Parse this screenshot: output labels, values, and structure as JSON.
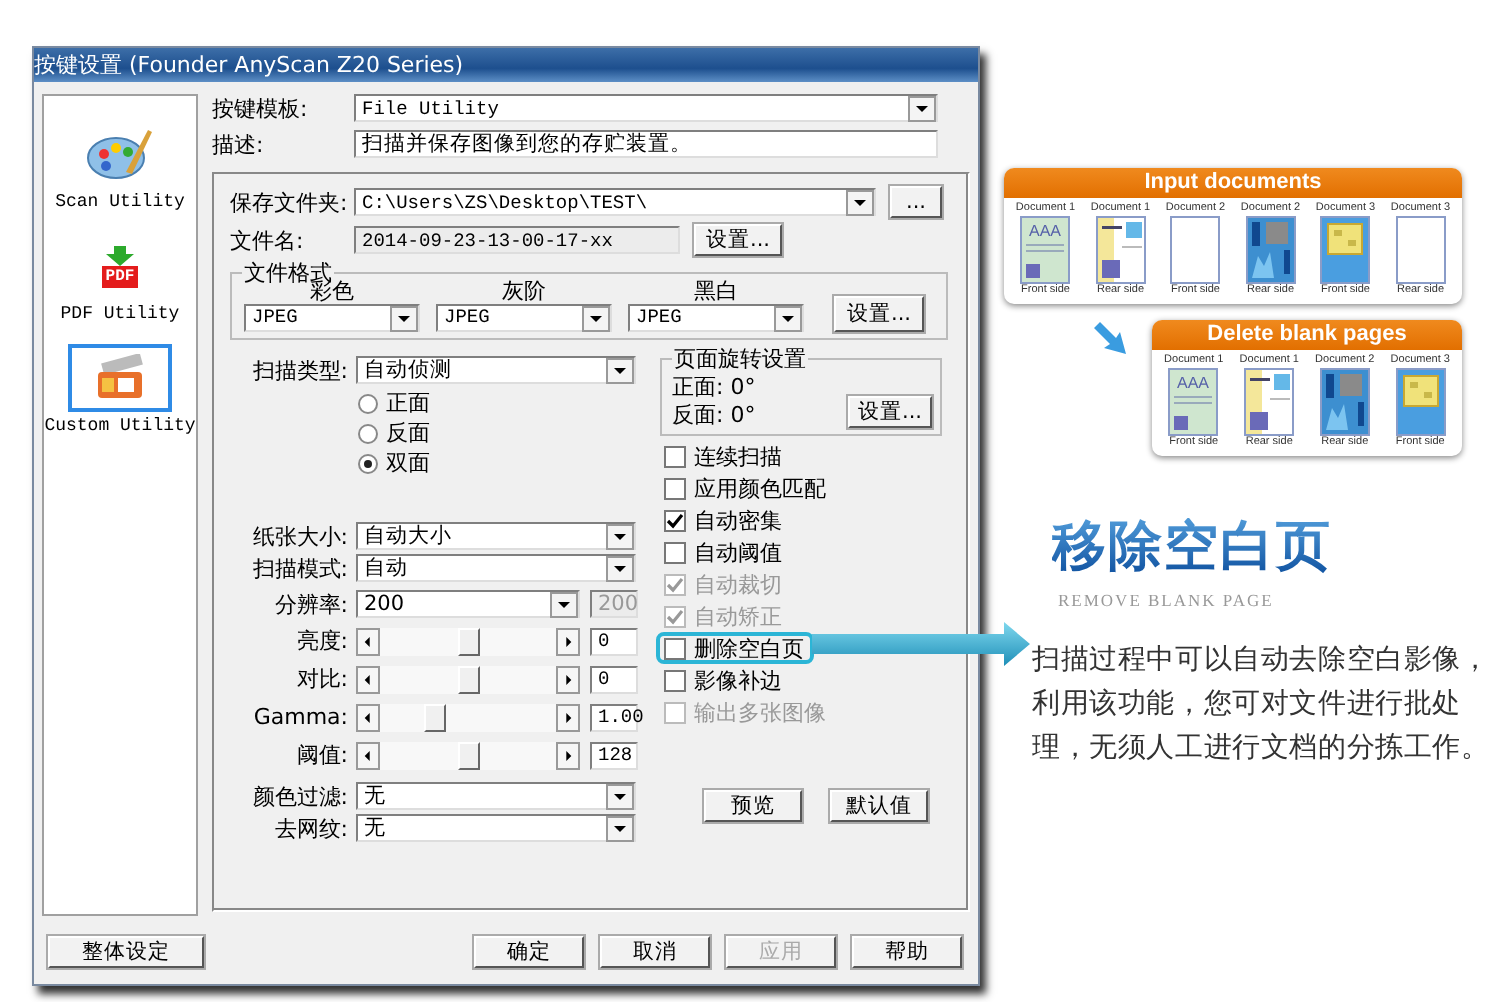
{
  "window": {
    "title": "按键设置 (Founder AnyScan Z20 Series)"
  },
  "sidebar": {
    "items": [
      {
        "label": "Scan Utility",
        "kind": "palette",
        "selected": false
      },
      {
        "label": "PDF Utility",
        "kind": "pdf",
        "badge": "PDF",
        "selected": false
      },
      {
        "label": "Custom Utility",
        "kind": "custom",
        "selected": true
      }
    ]
  },
  "template": {
    "label": "按键模板:",
    "value": "File Utility"
  },
  "description": {
    "label": "描述:",
    "value": "扫描并保存图像到您的存贮装置。"
  },
  "save_folder": {
    "label": "保存文件夹:",
    "value": "C:\\Users\\ZS\\Desktop\\TEST\\",
    "button": "..."
  },
  "file_name": {
    "label": "文件名:",
    "value": "2014-09-23-13-00-17-xx",
    "button": "设置..."
  },
  "file_format": {
    "title": "文件格式",
    "columns": [
      {
        "label": "彩色",
        "value": "JPEG"
      },
      {
        "label": "灰阶",
        "value": "JPEG"
      },
      {
        "label": "黑白",
        "value": "JPEG"
      }
    ],
    "button": "设置..."
  },
  "scan_type": {
    "label": "扫描类型:",
    "value": "自动侦测",
    "options": [
      {
        "label": "正面",
        "selected": false
      },
      {
        "label": "反面",
        "selected": false
      },
      {
        "label": "双面",
        "selected": true
      }
    ]
  },
  "settings": [
    {
      "kind": "select",
      "label": "纸张大小:",
      "value": "自动大小"
    },
    {
      "kind": "select",
      "label": "扫描模式:",
      "value": "自动"
    },
    {
      "kind": "select_value",
      "label": "分辨率:",
      "value": "200",
      "reading": "200"
    },
    {
      "kind": "slider",
      "label": "亮度:",
      "level": 0.5,
      "reading": "0"
    },
    {
      "kind": "slider",
      "label": "对比:",
      "level": 0.5,
      "reading": "0"
    },
    {
      "kind": "slider",
      "label": "Gamma:",
      "level": 0.28,
      "reading": "1.00"
    },
    {
      "kind": "slider",
      "label": "阈值:",
      "level": 0.5,
      "reading": "128"
    },
    {
      "kind": "select",
      "label": "颜色过滤:",
      "value": "无"
    },
    {
      "kind": "select",
      "label": "去网纹:",
      "value": "无"
    }
  ],
  "rotation": {
    "title": "页面旋转设置",
    "front": "正面: 0°",
    "back": "反面: 0°",
    "button": "设置..."
  },
  "options": [
    {
      "label": "连续扫描",
      "checked": false,
      "disabled": false,
      "highlighted": false
    },
    {
      "label": "应用颜色匹配",
      "checked": false,
      "disabled": false,
      "highlighted": false
    },
    {
      "label": "自动密集",
      "checked": true,
      "disabled": false,
      "highlighted": false
    },
    {
      "label": "自动阈值",
      "checked": false,
      "disabled": false,
      "highlighted": false
    },
    {
      "label": "自动裁切",
      "checked": true,
      "disabled": true,
      "highlighted": false
    },
    {
      "label": "自动矫正",
      "checked": true,
      "disabled": true,
      "highlighted": false
    },
    {
      "label": "删除空白页",
      "checked": false,
      "disabled": false,
      "highlighted": true
    },
    {
      "label": "影像补边",
      "checked": false,
      "disabled": false,
      "highlighted": false
    },
    {
      "label": "输出多张图像",
      "checked": false,
      "disabled": true,
      "highlighted": false
    }
  ],
  "actions": [
    "预览",
    "默认值"
  ],
  "footer": {
    "left": "整体设定",
    "buttons": [
      {
        "label": "确定",
        "disabled": false
      },
      {
        "label": "取消",
        "disabled": false
      },
      {
        "label": "应用",
        "disabled": true
      },
      {
        "label": "帮助",
        "disabled": false
      }
    ]
  },
  "infographic": {
    "input": {
      "title": "Input documents",
      "documents": [
        {
          "name": "Document 1",
          "side": "Front side",
          "kind": "text",
          "heading": "AAA"
        },
        {
          "name": "Document 1",
          "side": "Rear side",
          "kind": "form"
        },
        {
          "name": "Document 2",
          "side": "Front side",
          "kind": "blank"
        },
        {
          "name": "Document 2",
          "side": "Rear side",
          "kind": "chart"
        },
        {
          "name": "Document 3",
          "side": "Front side",
          "kind": "diagram"
        },
        {
          "name": "Document 3",
          "side": "Rear side",
          "kind": "blank"
        }
      ]
    },
    "output": {
      "title": "Delete blank pages",
      "documents": [
        {
          "name": "Document 1",
          "side": "Front side",
          "kind": "text",
          "heading": "AAA"
        },
        {
          "name": "Document 1",
          "side": "Rear side",
          "kind": "form"
        },
        {
          "name": "Document 2",
          "side": "Rear side",
          "kind": "chart"
        },
        {
          "name": "Document 3",
          "side": "Front side",
          "kind": "diagram"
        }
      ]
    }
  },
  "feature": {
    "title": "移除空白页",
    "subtitle": "REMOVE BLANK PAGE",
    "text": "扫描过程中可以自动去除空白影像，利用该功能，您可对文件进行批处理，无须人工进行文档的分拣工作。"
  }
}
